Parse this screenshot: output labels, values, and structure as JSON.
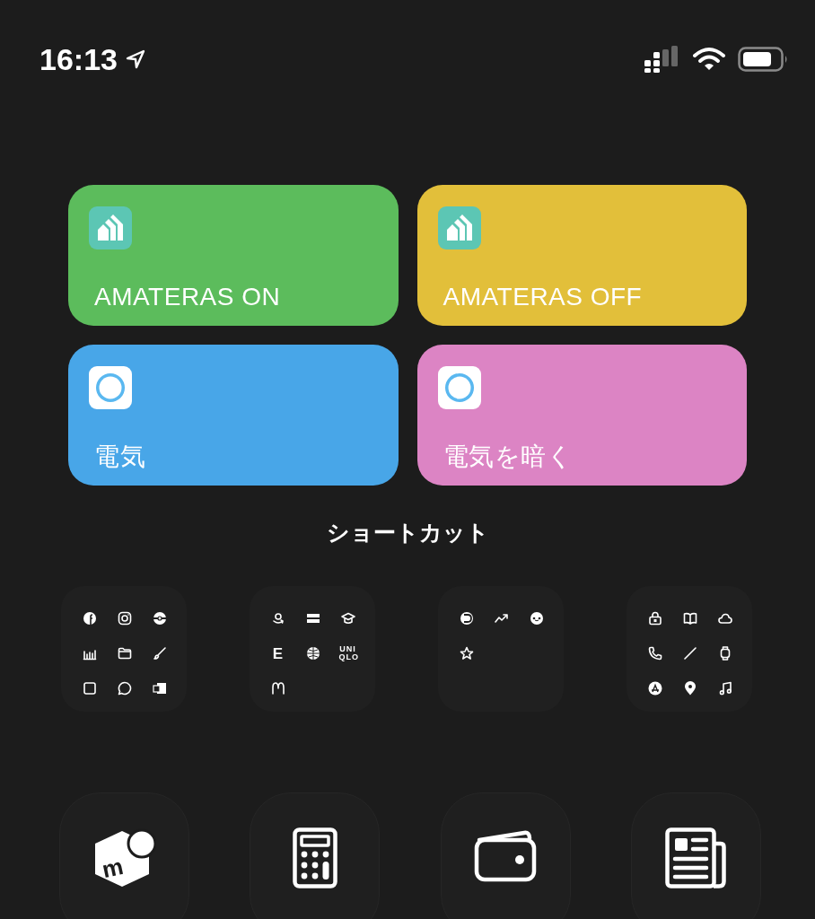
{
  "status_bar": {
    "time": "16:13"
  },
  "widgets": [
    {
      "label": "AMATERAS ON",
      "color": "#5cbc5c",
      "kind": "house"
    },
    {
      "label": "AMATERAS OFF",
      "color": "#e2bf3a",
      "kind": "house"
    },
    {
      "label": "電気",
      "color": "#48a6e8",
      "kind": "ring"
    },
    {
      "label": "電気を暗く",
      "color": "#dc84c4",
      "kind": "ring"
    }
  ],
  "section_title": "ショートカット",
  "folders": [
    {
      "icons": [
        {
          "kind": "circle"
        },
        {
          "kind": "camera"
        },
        {
          "kind": "ball"
        },
        {
          "kind": "bars"
        },
        {
          "kind": "folder"
        },
        {
          "kind": "brush"
        },
        {
          "kind": "square"
        },
        {
          "kind": "bubble"
        },
        {
          "kind": "card"
        }
      ]
    },
    {
      "icons": [
        {
          "kind": "smile"
        },
        {
          "kind": "stripe"
        },
        {
          "kind": "cap"
        },
        {
          "kind": "text",
          "text": "E"
        },
        {
          "kind": "globe"
        },
        {
          "kind": "text",
          "text": "UNI QLO"
        },
        {
          "kind": "arches"
        }
      ]
    },
    {
      "icons": [
        {
          "kind": "disc"
        },
        {
          "kind": "trend"
        },
        {
          "kind": "face"
        },
        {
          "kind": "star"
        }
      ]
    },
    {
      "icons": [
        {
          "kind": "lock"
        },
        {
          "kind": "book"
        },
        {
          "kind": "cloud"
        },
        {
          "kind": "phone"
        },
        {
          "kind": "pencil"
        },
        {
          "kind": "watch"
        },
        {
          "kind": "compass"
        },
        {
          "kind": "pin"
        },
        {
          "kind": "music"
        }
      ]
    }
  ],
  "dock": [
    {
      "kind": "cube",
      "text": "m"
    },
    {
      "kind": "calculator"
    },
    {
      "kind": "wallet"
    },
    {
      "kind": "newspaper"
    }
  ]
}
